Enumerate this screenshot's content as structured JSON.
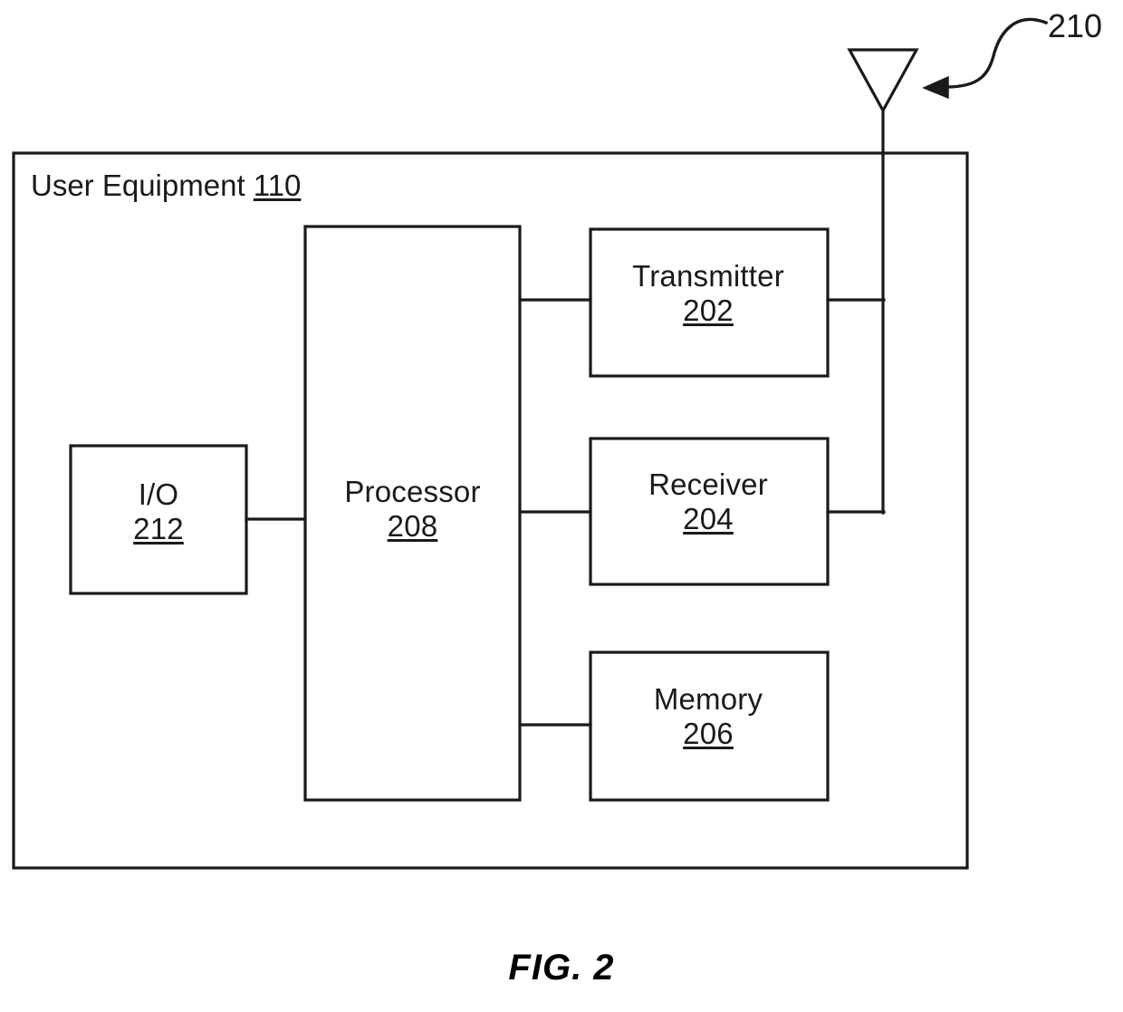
{
  "figure": {
    "caption": "FIG. 2",
    "outer_box": {
      "title_text": "User Equipment",
      "title_ref": "110",
      "name": "User Equipment 110"
    },
    "antenna": {
      "ref": "210",
      "shape": "triangle-antenna-icon"
    },
    "blocks": [
      {
        "id": "io",
        "title": "I/O",
        "ref": "212"
      },
      {
        "id": "processor",
        "title": "Processor",
        "ref": "208"
      },
      {
        "id": "transmitter",
        "title": "Transmitter",
        "ref": "202"
      },
      {
        "id": "receiver",
        "title": "Receiver",
        "ref": "204"
      },
      {
        "id": "memory",
        "title": "Memory",
        "ref": "206"
      }
    ],
    "connections": [
      {
        "from": "io",
        "to": "processor"
      },
      {
        "from": "processor",
        "to": "transmitter"
      },
      {
        "from": "processor",
        "to": "receiver"
      },
      {
        "from": "processor",
        "to": "memory"
      },
      {
        "from": "transmitter",
        "to": "antenna"
      },
      {
        "from": "receiver",
        "to": "antenna"
      }
    ],
    "colors": {
      "stroke": "#1a1a1a",
      "text": "#1a1a1a",
      "background": "#ffffff"
    }
  }
}
